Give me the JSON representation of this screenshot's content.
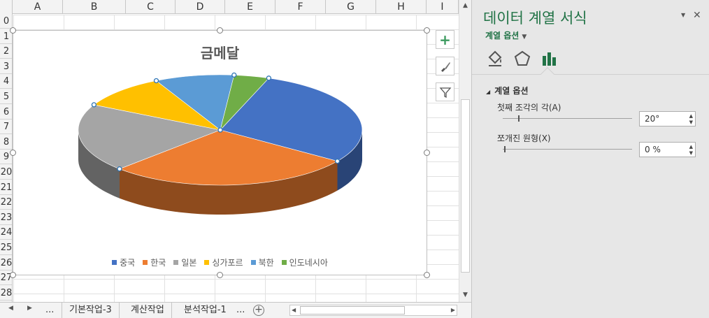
{
  "columns": [
    "A",
    "B",
    "C",
    "D",
    "E",
    "F",
    "G",
    "H",
    "I"
  ],
  "rows": [
    "0",
    "1",
    "2",
    "3",
    "4",
    "5",
    "6",
    "7",
    "8",
    "9",
    "20",
    "21",
    "22",
    "23",
    "24",
    "25",
    "26",
    "27",
    "28"
  ],
  "chart_data": {
    "type": "pie",
    "title": "금메달",
    "categories": [
      "중국",
      "한국",
      "일본",
      "싱가포르",
      "북한",
      "인도네시아"
    ],
    "values": [
      29,
      28,
      20,
      10,
      9,
      4
    ],
    "colors": [
      "#4472c4",
      "#ed7d31",
      "#a5a5a5",
      "#ffc000",
      "#5b9bd5",
      "#70ad47"
    ],
    "legend_position": "bottom"
  },
  "sheet_tabs": {
    "ellipsis_left": "...",
    "tabs": [
      "기본작업-3",
      "계산작업",
      "분석작업-1"
    ],
    "ellipsis_right": "...",
    "add": "+"
  },
  "pane": {
    "title": "데이터 계열 서식",
    "series_options_dropdown": "계열 옵션",
    "section": "계열 옵션",
    "first_slice_angle_label": "첫째 조각의 각(A)",
    "first_slice_angle_value": "20°",
    "first_slice_angle_fraction": 0.056,
    "explosion_label": "쪼개진 원형(X)",
    "explosion_value": "0 %",
    "explosion_fraction": 0.0
  }
}
